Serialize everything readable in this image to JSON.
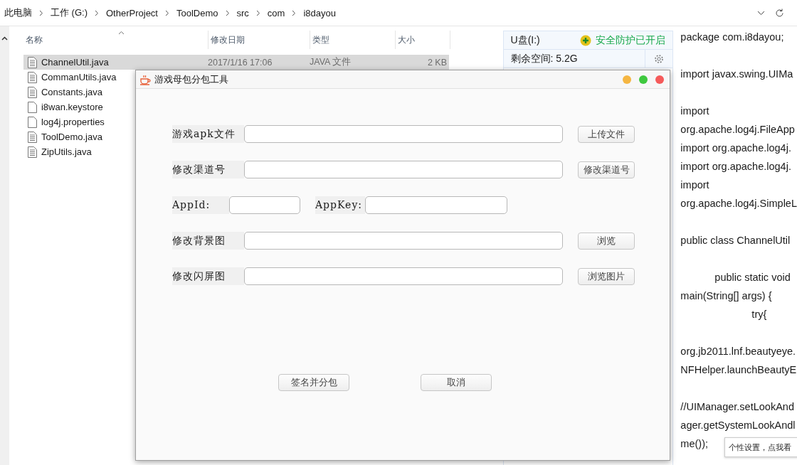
{
  "breadcrumb": [
    "此电脑",
    "工作 (G:)",
    "OtherProject",
    "ToolDemo",
    "src",
    "com",
    "i8dayou"
  ],
  "file_list": {
    "columns": [
      "名称",
      "修改日期",
      "类型",
      "大小"
    ],
    "rows": [
      {
        "name": "ChannelUtil.java",
        "kind": "lined",
        "selected": true,
        "modified": "2017/1/16 17:06",
        "type": "JAVA 文件",
        "size": "2 KB"
      },
      {
        "name": "CommanUtils.java",
        "kind": "lined",
        "selected": false
      },
      {
        "name": "Constants.java",
        "kind": "lined",
        "selected": false
      },
      {
        "name": "i8wan.keystore",
        "kind": "plain",
        "selected": false
      },
      {
        "name": "log4j.properties",
        "kind": "plain",
        "selected": false
      },
      {
        "name": "ToolDemo.java",
        "kind": "lined",
        "selected": false
      },
      {
        "name": "ZipUtils.java",
        "kind": "lined",
        "selected": false
      }
    ]
  },
  "drive_panel": {
    "name": "U盘(I:)",
    "protection": "安全防护已开启",
    "free_space": "剩余空间: 5.2G"
  },
  "code_lines": [
    {
      "text": "package com.i8dayou;",
      "kind": "flat"
    },
    {
      "kind": "blank"
    },
    {
      "text": "import javax.swing.UIMa",
      "kind": "flat"
    },
    {
      "kind": "blank"
    },
    {
      "text": "import",
      "kind": "flat"
    },
    {
      "text": "org.apache.log4j.FileApp",
      "kind": "flat"
    },
    {
      "text": "import org.apache.log4j.",
      "kind": "flat"
    },
    {
      "text": "import org.apache.log4j.",
      "kind": "flat"
    },
    {
      "text": "import",
      "kind": "flat"
    },
    {
      "text": "org.apache.log4j.SimpleL",
      "kind": "flat"
    },
    {
      "kind": "blank"
    },
    {
      "text": "public class ChannelUtil",
      "kind": "flat"
    },
    {
      "kind": "blank"
    },
    {
      "text": "public static void",
      "kind": "indent"
    },
    {
      "text": "main(String[] args) {",
      "kind": "flat"
    },
    {
      "text": "try{",
      "kind": "deep"
    },
    {
      "kind": "blank"
    },
    {
      "text": "org.jb2011.lnf.beautyeye.",
      "kind": "flat"
    },
    {
      "text": "NFHelper.launchBeautyE",
      "kind": "flat"
    },
    {
      "kind": "blank"
    },
    {
      "text": "//UIManager.setLookAnd",
      "kind": "flat"
    },
    {
      "text": "ager.getSystemLookAndl",
      "kind": "flat"
    },
    {
      "text": "me());",
      "kind": "flat"
    }
  ],
  "dialog": {
    "title": "游戏母包分包工具",
    "rows": [
      {
        "kind": "field",
        "label": "游戏apk文件",
        "button": "上传文件"
      },
      {
        "kind": "field",
        "label": "修改渠道号",
        "button": "修改渠道号"
      },
      {
        "kind": "pair",
        "fields": [
          {
            "label": "AppId:"
          },
          {
            "label": "AppKey:"
          }
        ]
      },
      {
        "kind": "field",
        "label": "修改背景图",
        "button": "浏览"
      },
      {
        "kind": "field",
        "label": "修改闪屏图",
        "button": "浏览图片"
      }
    ],
    "buttons": [
      "签名并分包",
      "取消"
    ]
  },
  "tooltip": "个性设置，点我看"
}
